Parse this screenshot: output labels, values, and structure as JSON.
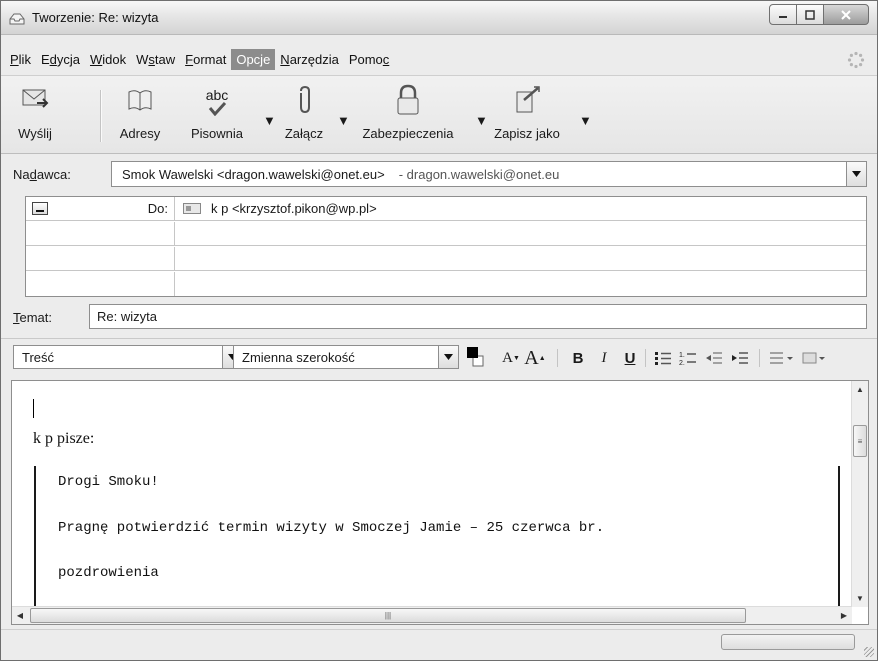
{
  "window": {
    "title": "Tworzenie: Re: wizyta",
    "controls": [
      "minimize-icon",
      "maximize-icon",
      "close-icon"
    ]
  },
  "menu": {
    "items": [
      {
        "label": "Plik",
        "accel": "P",
        "rest": "lik"
      },
      {
        "label": "Edycja",
        "pre": "E",
        "accel": "d",
        "rest": "ycja"
      },
      {
        "label": "Widok",
        "accel": "W",
        "rest": "idok"
      },
      {
        "label": "Wstaw",
        "pre": "W",
        "accel": "s",
        "rest": "taw"
      },
      {
        "label": "Format",
        "accel": "F",
        "rest": "ormat"
      },
      {
        "label": "Opcje",
        "pre": "Opc",
        "accel": "j",
        "rest": "e",
        "active": true
      },
      {
        "label": "Narzędzia",
        "accel": "N",
        "rest": "arzędzia"
      },
      {
        "label": "Pomoc",
        "pre": "Pomo",
        "accel": "c",
        "rest": ""
      }
    ]
  },
  "toolbar": {
    "send": "Wyślij",
    "address": "Adresy",
    "spelling": "Pisownia",
    "spelling_icon_text": "abc",
    "attach": "Załącz",
    "security": "Zabezpieczenia",
    "saveas": "Zapisz jako"
  },
  "header": {
    "sender_label": "Nadawca:",
    "sender_value": "Smok Wawelski <dragon.wawelski@onet.eu>",
    "sender_account": "- dragon.wawelski@onet.eu",
    "to_label": "Do:",
    "to_value": "k p <krzysztof.pikon@wp.pl>",
    "subject_label": "Temat:",
    "subject_value": "Re: wizyta"
  },
  "format": {
    "paragraph": "Treść",
    "font": "Zmienna szerokość",
    "bold": "B",
    "italic": "I",
    "underline": "U"
  },
  "body": {
    "attribution": "k p pisze:",
    "quoted": [
      "Drogi Smoku!",
      "Pragnę potwierdzić termin wizyty w Smoczej Jamie – 25 czerwca br.",
      "pozdrowienia"
    ]
  },
  "colors": {
    "menu_active_bg": "#8c8c8c",
    "border": "#8e8e8e"
  }
}
